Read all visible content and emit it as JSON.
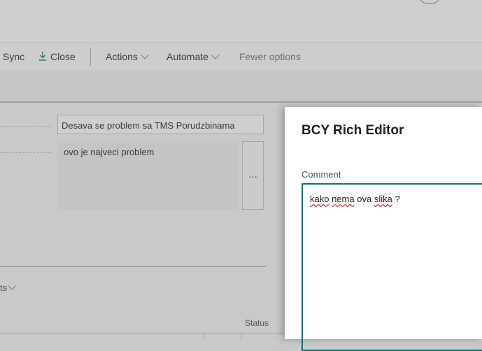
{
  "toolbar": {
    "sync_label": "Sync",
    "close_label": "Close",
    "actions_label": "Actions",
    "automate_label": "Automate",
    "fewer_options_label": "Fewer options"
  },
  "form": {
    "title_value": "Desava se problem sa TMS Porudzbinama",
    "description_value": "ovo je najveci problem",
    "more_button_label": "...",
    "lines_tab_suffix": "ts",
    "status_column_header": "Status"
  },
  "rich_editor": {
    "title": "BCY Rich Editor",
    "comment_label": "Comment",
    "comment_words": [
      "kako",
      "nema",
      "ova",
      "slika",
      "?"
    ]
  },
  "colors": {
    "accent": "#00787c",
    "spellcheck": "#d13438",
    "download_icon": "#1a7f5a"
  }
}
